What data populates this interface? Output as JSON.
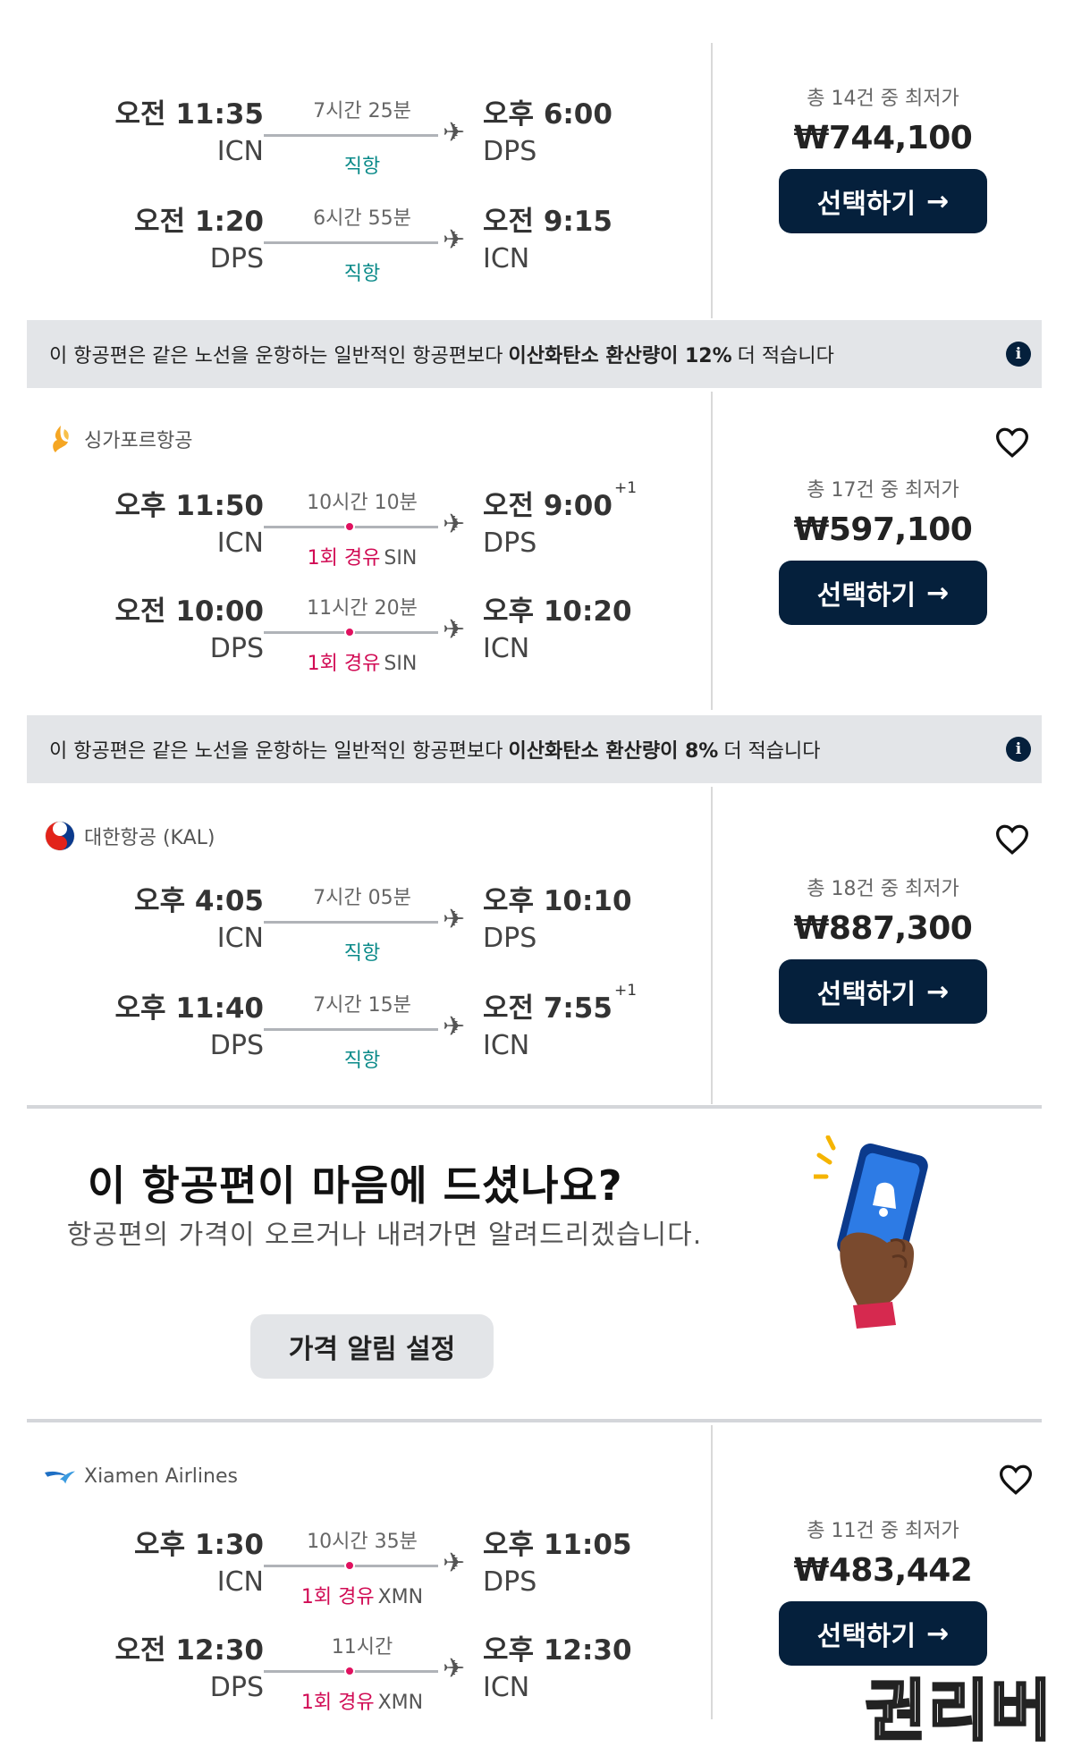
{
  "cards": [
    {
      "airline": "",
      "price_note": "총 14건 중 최저가",
      "price": "₩744,100",
      "select_label": "선택하기",
      "legs": [
        {
          "dep_time": "오전 11:35",
          "dep_code": "ICN",
          "duration": "7시간 25분",
          "stops": "직항",
          "via": "",
          "arr_time": "오후 6:00",
          "arr_sup": "",
          "arr_code": "DPS"
        },
        {
          "dep_time": "오전 1:20",
          "dep_code": "DPS",
          "duration": "6시간 55분",
          "stops": "직항",
          "via": "",
          "arr_time": "오전 9:15",
          "arr_sup": "",
          "arr_code": "ICN"
        }
      ]
    },
    {
      "airline": "싱가포르항공",
      "price_note": "총 17건 중 최저가",
      "price": "₩597,100",
      "select_label": "선택하기",
      "legs": [
        {
          "dep_time": "오후 11:50",
          "dep_code": "ICN",
          "duration": "10시간 10분",
          "stops": "1회 경유",
          "via": "SIN",
          "arr_time": "오전 9:00",
          "arr_sup": "+1",
          "arr_code": "DPS"
        },
        {
          "dep_time": "오전 10:00",
          "dep_code": "DPS",
          "duration": "11시간 20분",
          "stops": "1회 경유",
          "via": "SIN",
          "arr_time": "오후 10:20",
          "arr_sup": "",
          "arr_code": "ICN"
        }
      ]
    },
    {
      "airline": "대한항공 (KAL)",
      "price_note": "총 18건 중 최저가",
      "price": "₩887,300",
      "select_label": "선택하기",
      "legs": [
        {
          "dep_time": "오후 4:05",
          "dep_code": "ICN",
          "duration": "7시간 05분",
          "stops": "직항",
          "via": "",
          "arr_time": "오후 10:10",
          "arr_sup": "",
          "arr_code": "DPS"
        },
        {
          "dep_time": "오후 11:40",
          "dep_code": "DPS",
          "duration": "7시간 15분",
          "stops": "직항",
          "via": "",
          "arr_time": "오전 7:55",
          "arr_sup": "+1",
          "arr_code": "ICN"
        }
      ]
    },
    {
      "airline": "Xiamen Airlines",
      "price_note": "총 11건 중 최저가",
      "price": "₩483,442",
      "select_label": "선택하기",
      "legs": [
        {
          "dep_time": "오후 1:30",
          "dep_code": "ICN",
          "duration": "10시간 35분",
          "stops": "1회 경유",
          "via": "XMN",
          "arr_time": "오후 11:05",
          "arr_sup": "",
          "arr_code": "DPS"
        },
        {
          "dep_time": "오전 12:30",
          "dep_code": "DPS",
          "duration": "11시간",
          "stops": "1회 경유",
          "via": "XMN",
          "arr_time": "오후 12:30",
          "arr_sup": "",
          "arr_code": "ICN"
        }
      ]
    }
  ],
  "banners": [
    {
      "prefix": "이 항공편은 같은 노선을 운항하는 일반적인 항공편보다",
      "bold": "이산화탄소 환산량이 12%",
      "suffix": "더 적습니다"
    },
    {
      "prefix": "이 항공편은 같은 노선을 운항하는 일반적인 항공편보다",
      "bold": "이산화탄소 환산량이 8%",
      "suffix": "더 적습니다"
    }
  ],
  "promo": {
    "title": "이 항공편이 마음에 드셨나요?",
    "text": "항공편의 가격이 오르거나 내려가면 알려드리겠습니다.",
    "button": "가격 알림 설정"
  },
  "watermark": "권리버",
  "icons": {
    "plane": "airplane-icon",
    "heart": "heart-outline-icon",
    "info": "info-icon",
    "arrow": "arrow-right-icon"
  },
  "colors": {
    "button_bg": "#05203c",
    "direct": "#0a8a89",
    "layover": "#d10b54",
    "banner_bg": "#e3e5e8"
  }
}
